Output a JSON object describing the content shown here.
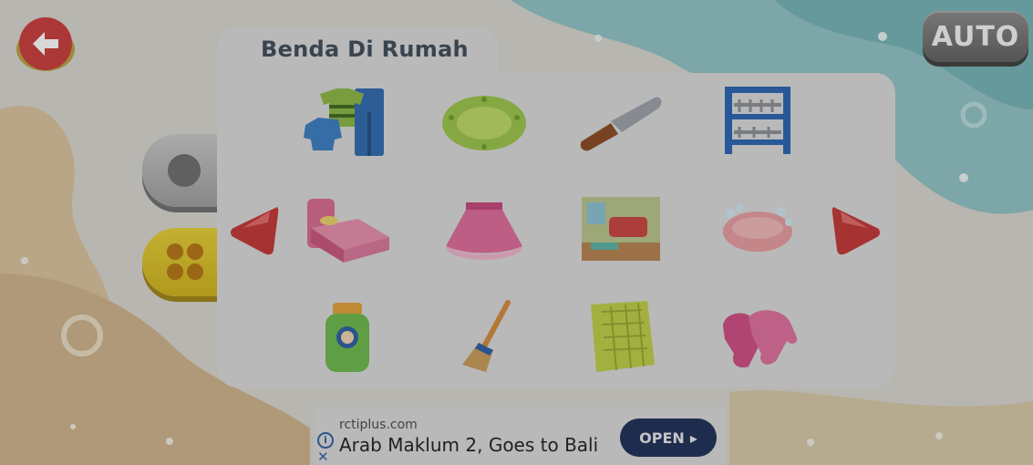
{
  "game": {
    "category_title": "Benda Di Rumah",
    "auto_label": "AUTO"
  },
  "icons": {
    "back": "back-arrow-icon",
    "prev": "prev-arrow-icon",
    "next": "next-arrow-icon",
    "mode_tab_gray": "circle-icon",
    "mode_tab_yellow": "grid-dots-icon"
  },
  "items": [
    {
      "name": "clothes"
    },
    {
      "name": "plate"
    },
    {
      "name": "knife"
    },
    {
      "name": "dish-rack"
    },
    {
      "name": "bed"
    },
    {
      "name": "skirt"
    },
    {
      "name": "living-room"
    },
    {
      "name": "soap-dish"
    },
    {
      "name": "shampoo-bottle"
    },
    {
      "name": "broom"
    },
    {
      "name": "towel"
    },
    {
      "name": "gloves"
    }
  ],
  "ad": {
    "domain": "rctiplus.com",
    "title": "Arab Maklum 2, Goes to Bali",
    "open_label": "OPEN",
    "info_icon": "info-icon",
    "close_icon": "close-icon",
    "open_icon": "play-triangle-icon"
  },
  "colors": {
    "panel": "#d9d9d9",
    "title": "#3f4b57",
    "arrow_red": "#d23a3a",
    "ad_button": "#1d2f57"
  }
}
